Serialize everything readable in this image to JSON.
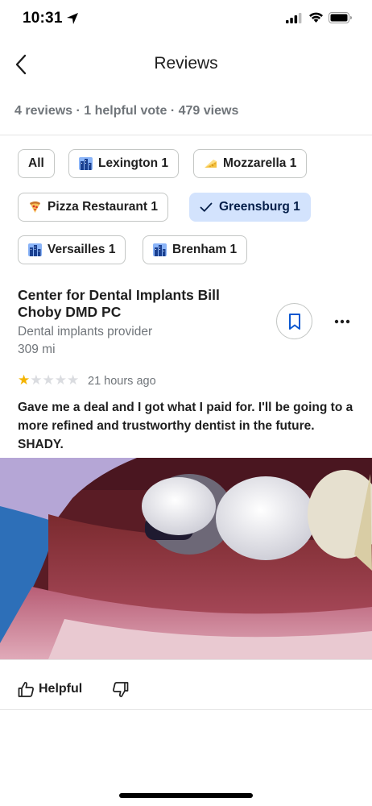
{
  "status_bar": {
    "time": "10:31"
  },
  "header": {
    "title": "Reviews"
  },
  "stats": "4 reviews · 1 helpful vote · 479 views",
  "filters": [
    {
      "label": "All",
      "icon": "",
      "selected": false
    },
    {
      "label": "Lexington 1",
      "icon": "city-icon",
      "selected": false
    },
    {
      "label": "Mozzarella 1",
      "icon": "cheese-icon",
      "selected": false
    },
    {
      "label": "Pizza Restaurant 1",
      "icon": "pizza-icon",
      "selected": false
    },
    {
      "label": "Greensburg 1",
      "icon": "check-icon",
      "selected": true
    },
    {
      "label": "Versailles 1",
      "icon": "city-icon",
      "selected": false
    },
    {
      "label": "Brenham 1",
      "icon": "city-icon",
      "selected": false
    }
  ],
  "review": {
    "place_name": "Center for Dental Implants Bill Choby DMD PC",
    "place_type": "Dental implants provider",
    "distance": "309 mi",
    "rating": 1,
    "max_rating": 5,
    "time_ago": "21 hours ago",
    "text": "Gave me a deal and I got what I paid for.  I'll be going to a more refined and trustworthy dentist in the future. SHADY.",
    "photo_subject": "photo-teeth"
  },
  "actions": {
    "helpful_label": "Helpful"
  },
  "colors": {
    "selected_chip_bg": "#d3e3fd",
    "star_on": "#f4b400",
    "star_off": "#dadce0",
    "accent": "#0b57d0"
  }
}
